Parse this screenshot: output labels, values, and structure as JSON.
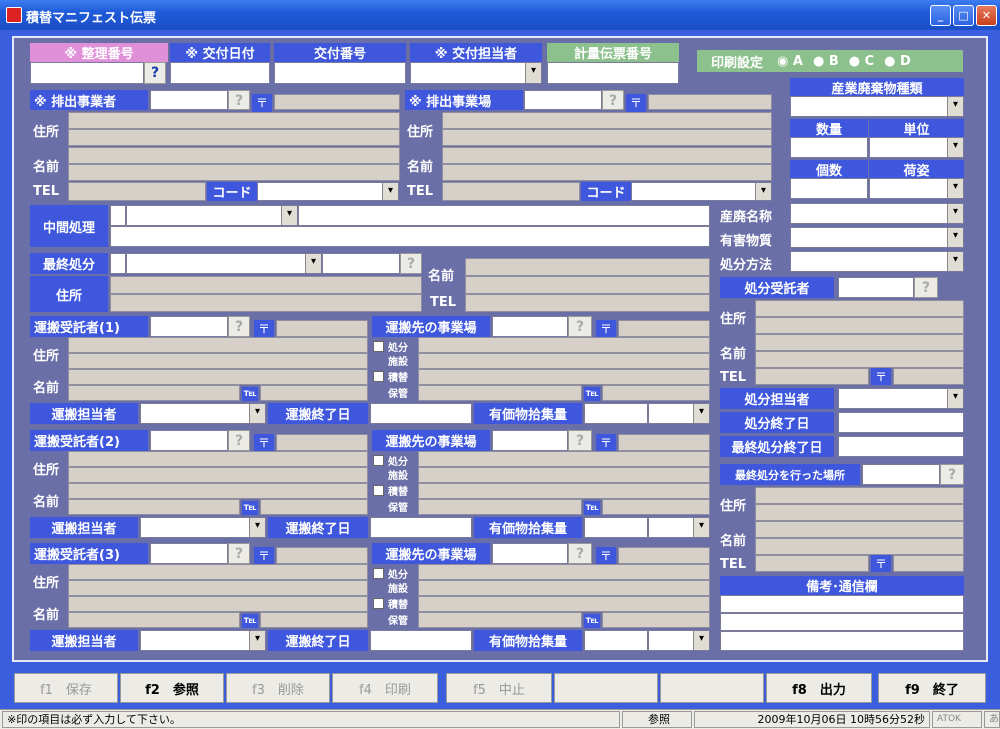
{
  "window": {
    "title": "積替マニフェスト伝票",
    "min": "_",
    "max": "□",
    "close": "✕"
  },
  "top": {
    "seiri": "※ 整理番号",
    "kofu_date": "※ 交付日付",
    "kofu_no": "交付番号",
    "kofu_tanto": "※ 交付担当者",
    "keiryo": "計量伝票番号",
    "print_setting": "印刷設定",
    "opt_a": "A",
    "opt_b": "B",
    "opt_c": "C",
    "opt_d": "D"
  },
  "haishutsu": {
    "jigyosha": "※ 排出事業者",
    "jigyojo": "※ 排出事業場",
    "jusho": "住所",
    "namae": "名前",
    "tel": "TEL",
    "code": "コード"
  },
  "chukan": "中間処理",
  "saishu": "最終処分",
  "jusho": "住所",
  "namae": "名前",
  "tel": "TEL",
  "right": {
    "shurui": "産業廃棄物種類",
    "suryo": "数量",
    "tani": "単位",
    "kosu": "個数",
    "nisugata": "荷姿",
    "sanpai_name": "産廃名称",
    "yugai": "有害物質",
    "hoho": "処分方法",
    "jutakusha": "処分受託者",
    "tanto": "処分担当者",
    "end": "処分終了日",
    "final_end": "最終処分終了日",
    "final_place": "最終処分を行った場所",
    "biko": "備考･通信欄"
  },
  "unpan": [
    {
      "title": "運搬受託者(1)"
    },
    {
      "title": "運搬受託者(2)"
    },
    {
      "title": "運搬受託者(3)"
    }
  ],
  "unpan_labels": {
    "saki": "運搬先の事業場",
    "shobun": "処分",
    "shisetsu": "施設",
    "tsumikae": "積替",
    "hokan": "保管",
    "tanto": "運搬担当者",
    "end": "運搬終了日",
    "yuka": "有価物拾集量",
    "tel_icon": "℡",
    "zip": "〒",
    "help": "?"
  },
  "fkeys": [
    "f1　保存",
    "f2　参照",
    "f3　削除",
    "f4　印刷",
    "f5　中止",
    "",
    "",
    "f8　出力",
    "f9　終了"
  ],
  "status": {
    "msg": "※印の項目は必ず入力して下さい。",
    "mode": "参照",
    "datetime": "2009年10月06日 10時56分52秒",
    "ime": "ATOK",
    "ime2": "あ"
  }
}
